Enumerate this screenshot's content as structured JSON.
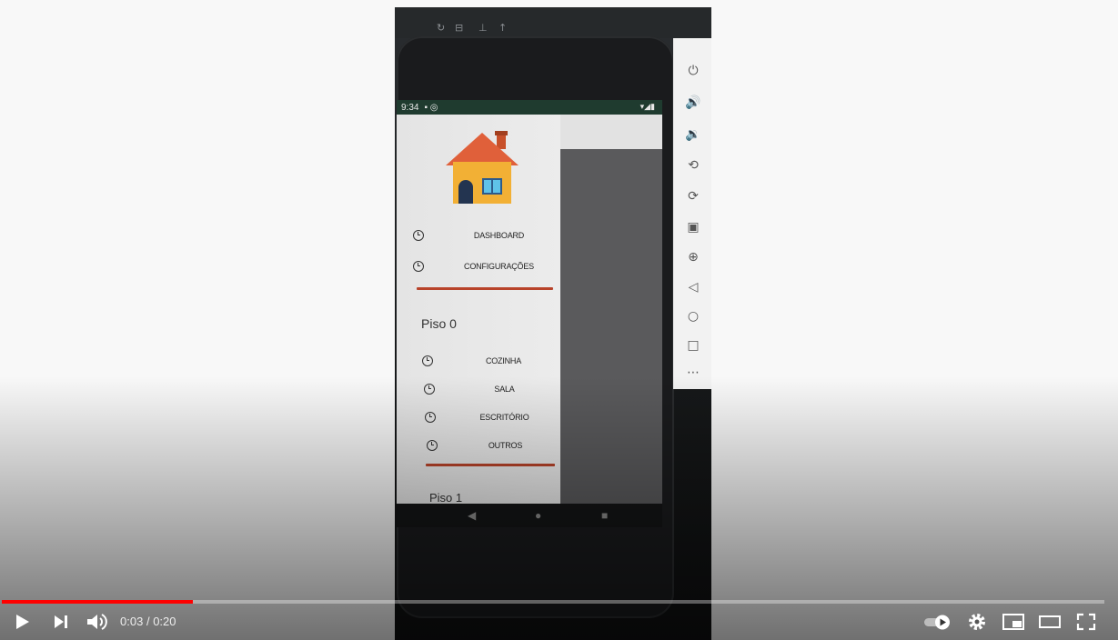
{
  "player": {
    "current_time": "0:03",
    "duration": "0:20",
    "separator": "/",
    "progress": 0.173
  },
  "phone": {
    "status_time": "9:34",
    "drawer": {
      "top_items": [
        {
          "label": "DASHBOARD"
        },
        {
          "label": "CONFIGURAÇÕES"
        }
      ],
      "section0_title": "Piso 0",
      "section0_items": [
        {
          "label": "COZINHA"
        },
        {
          "label": "SALA"
        },
        {
          "label": "ESCRITÓRIO"
        },
        {
          "label": "OUTROS"
        }
      ],
      "section1_title": "Piso 1"
    }
  },
  "colors": {
    "accent": "#ff0000",
    "divider": "#b8432a"
  },
  "icons": {
    "play": "play-icon",
    "next": "next-icon",
    "volume": "volume-icon",
    "autoplay": "autoplay-toggle",
    "settings": "gear-icon",
    "miniplayer": "miniplayer-icon",
    "theater": "theater-icon",
    "fullscreen": "fullscreen-icon"
  }
}
